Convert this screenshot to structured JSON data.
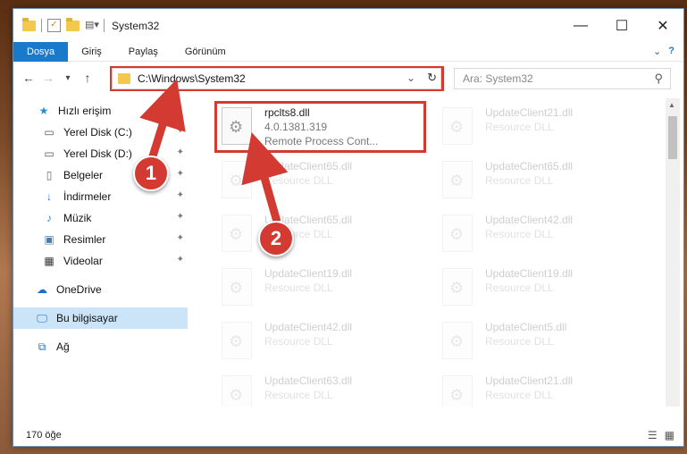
{
  "window": {
    "title": "System32"
  },
  "ribbon": {
    "tabs": [
      "Dosya",
      "Giriş",
      "Paylaş",
      "Görünüm"
    ],
    "active_tab": "Dosya"
  },
  "address": {
    "path": "C:\\Windows\\System32"
  },
  "search": {
    "placeholder": "Ara: System32"
  },
  "sidebar": {
    "items": [
      {
        "label": "Hızlı erişim",
        "icon": "star-icon",
        "pinned": false
      },
      {
        "label": "Yerel Disk (C:)",
        "icon": "drive-icon",
        "pinned": true
      },
      {
        "label": "Yerel Disk (D:)",
        "icon": "drive-icon",
        "pinned": true
      },
      {
        "label": "Belgeler",
        "icon": "documents-icon",
        "pinned": true
      },
      {
        "label": "İndirmeler",
        "icon": "download-icon",
        "pinned": true
      },
      {
        "label": "Müzik",
        "icon": "music-icon",
        "pinned": true
      },
      {
        "label": "Resimler",
        "icon": "pictures-icon",
        "pinned": true
      },
      {
        "label": "Videolar",
        "icon": "videos-icon",
        "pinned": true
      },
      {
        "label": "OneDrive",
        "icon": "cloud-icon",
        "pinned": false
      },
      {
        "label": "Bu bilgisayar",
        "icon": "computer-icon",
        "pinned": false,
        "selected": true
      },
      {
        "label": "Ağ",
        "icon": "network-icon",
        "pinned": false
      }
    ]
  },
  "files": [
    {
      "name": "rpclts8.dll",
      "line2": "4.0.1381.319",
      "line3": "Remote Process Cont...",
      "highlighted": true
    },
    {
      "name": "UpdateClient21.dll",
      "line2": "Resource DLL"
    },
    {
      "name": "UpdateClient65.dll",
      "line2": "Resource DLL"
    },
    {
      "name": "UpdateClient65.dll",
      "line2": "Resource DLL"
    },
    {
      "name": "UpdateClient65.dll",
      "line2": "Resource DLL"
    },
    {
      "name": "UpdateClient42.dll",
      "line2": "Resource DLL"
    },
    {
      "name": "UpdateClient19.dll",
      "line2": "Resource DLL"
    },
    {
      "name": "UpdateClient19.dll",
      "line2": "Resource DLL"
    },
    {
      "name": "UpdateClient42.dll",
      "line2": "Resource DLL"
    },
    {
      "name": "UpdateClient5.dll",
      "line2": "Resource DLL"
    },
    {
      "name": "UpdateClient63.dll",
      "line2": "Resource DLL"
    },
    {
      "name": "UpdateClient21.dll",
      "line2": "Resource DLL"
    }
  ],
  "status": {
    "count": "170 öğe"
  },
  "annotations": {
    "badge1": "1",
    "badge2": "2",
    "color": "#d33a32"
  }
}
